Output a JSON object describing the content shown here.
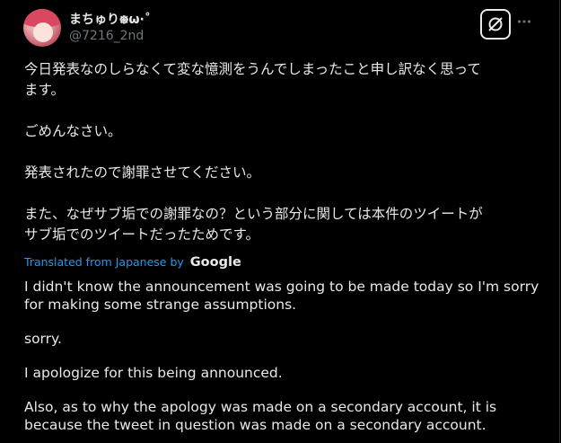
{
  "tweet": {
    "display_name": "まちゅり᪥ω·˚",
    "handle": "@7216_2nd",
    "grok_icon": "grok-icon",
    "more_icon": "more-icon",
    "original_paragraphs": [
      [
        "今日発表なのしらなくて変な憶測をうんでしまったこと申し訳なく思って",
        "ます。"
      ],
      [
        "ごめんなさい。"
      ],
      [
        "発表されたので謝罪させてください。"
      ],
      [
        "また、なぜサブ垢での謝罪なの？という部分に関しては本件のツイートが",
        "サブ垢でのツイートだったためです。"
      ]
    ],
    "translated_label": "Translated from Japanese by",
    "translator_brand": "Google",
    "translation_paragraphs": [
      [
        "I didn't know the announcement was going to be made today so I'm sorry",
        "for making some strange assumptions."
      ],
      [
        "sorry."
      ],
      [
        "I apologize for this being announced."
      ],
      [
        "Also, as to why the apology was made on a secondary account, it is",
        "because the tweet in question was made on a secondary account."
      ]
    ]
  },
  "colors": {
    "background": "#000000",
    "text": "#e7e9ea",
    "secondary": "#71767b",
    "link": "#1d9bf0"
  }
}
